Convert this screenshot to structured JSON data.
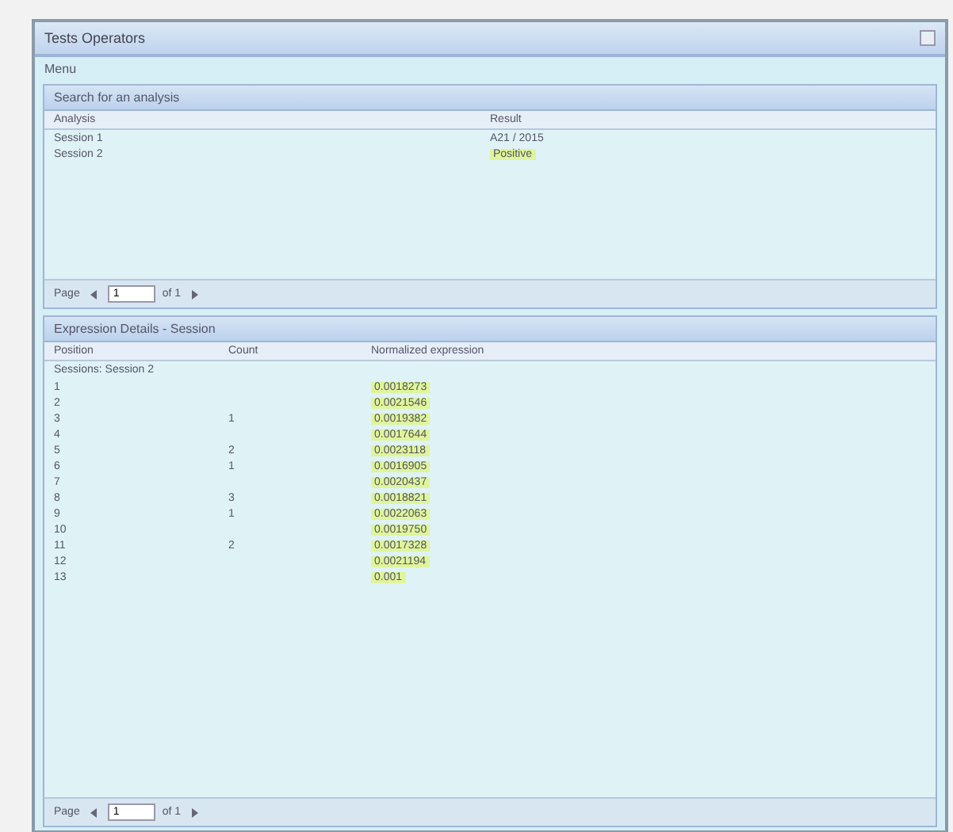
{
  "window": {
    "title": "Tests Operators"
  },
  "menu": [
    "Menu"
  ],
  "analysis_panel": {
    "title": "Search for an analysis",
    "columns": [
      "Analysis",
      "Result"
    ],
    "rows": [
      {
        "cells": [
          "Session 1",
          "A21 / 2015"
        ],
        "highlight": false
      },
      {
        "cells": [
          "Session 2",
          "Positive"
        ],
        "highlight": true
      }
    ],
    "pager": {
      "label": "Page",
      "value": "1",
      "total": "of 1"
    }
  },
  "details_panel": {
    "title": "Expression Details - Session",
    "columns": [
      "Position",
      "Count",
      "Normalized expression"
    ],
    "group": "Sessions: Session 2",
    "rows": [
      {
        "cells": [
          "1",
          "",
          "0.0018273"
        ]
      },
      {
        "cells": [
          "2",
          "",
          "0.0021546"
        ]
      },
      {
        "cells": [
          "3",
          "1",
          "0.0019382"
        ]
      },
      {
        "cells": [
          "4",
          "",
          "0.0017644"
        ]
      },
      {
        "cells": [
          "5",
          "2",
          "0.0023118"
        ]
      },
      {
        "cells": [
          "6",
          "1",
          "0.0016905"
        ]
      },
      {
        "cells": [
          "7",
          "",
          "0.0020437"
        ]
      },
      {
        "cells": [
          "8",
          "3",
          "0.0018821"
        ]
      },
      {
        "cells": [
          "9",
          "1",
          "0.0022063"
        ]
      },
      {
        "cells": [
          "10",
          "",
          "0.0019750"
        ]
      },
      {
        "cells": [
          "11",
          "2",
          "0.0017328"
        ]
      },
      {
        "cells": [
          "12",
          "",
          "0.0021194"
        ]
      },
      {
        "cells": [
          "13",
          "",
          "0.001"
        ]
      }
    ],
    "pager": {
      "label": "Page",
      "value": "1",
      "total": "of 1"
    }
  }
}
